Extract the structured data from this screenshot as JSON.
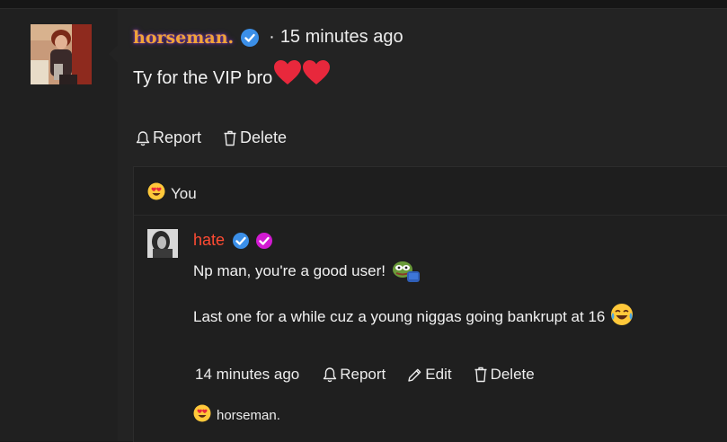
{
  "comment": {
    "username": "horseman.",
    "verified_badge": "blue-check-badge",
    "separator": "·",
    "time": "15 minutes ago",
    "message": "Ty for the VIP bro",
    "message_emoji": [
      "red-heart",
      "red-heart"
    ],
    "actions": {
      "report": "Report",
      "delete": "Delete"
    },
    "reaction": {
      "emoji": "heart-eyes-emoji",
      "label": "You"
    }
  },
  "reply": {
    "username": "hate",
    "badges": [
      "blue-check-badge",
      "magenta-check-badge"
    ],
    "line1": "Np man, you're a good user!",
    "line1_emoji": "pepe-emoji",
    "line2": "Last one for a while cuz a young niggas going bankrupt at 16",
    "line2_emoji": "crying-laughing-emoji",
    "time": "14 minutes ago",
    "actions": {
      "report": "Report",
      "edit": "Edit",
      "delete": "Delete"
    },
    "reaction": {
      "emoji": "heart-eyes-emoji",
      "label": "horseman."
    }
  },
  "colors": {
    "username_main": "#f0a438",
    "username_glow": "#6a2fa0",
    "username_reply": "#ff4b33",
    "badge_blue": "#3b8fe8",
    "badge_magenta": "#d21ad2",
    "heart": "#e8283c"
  }
}
